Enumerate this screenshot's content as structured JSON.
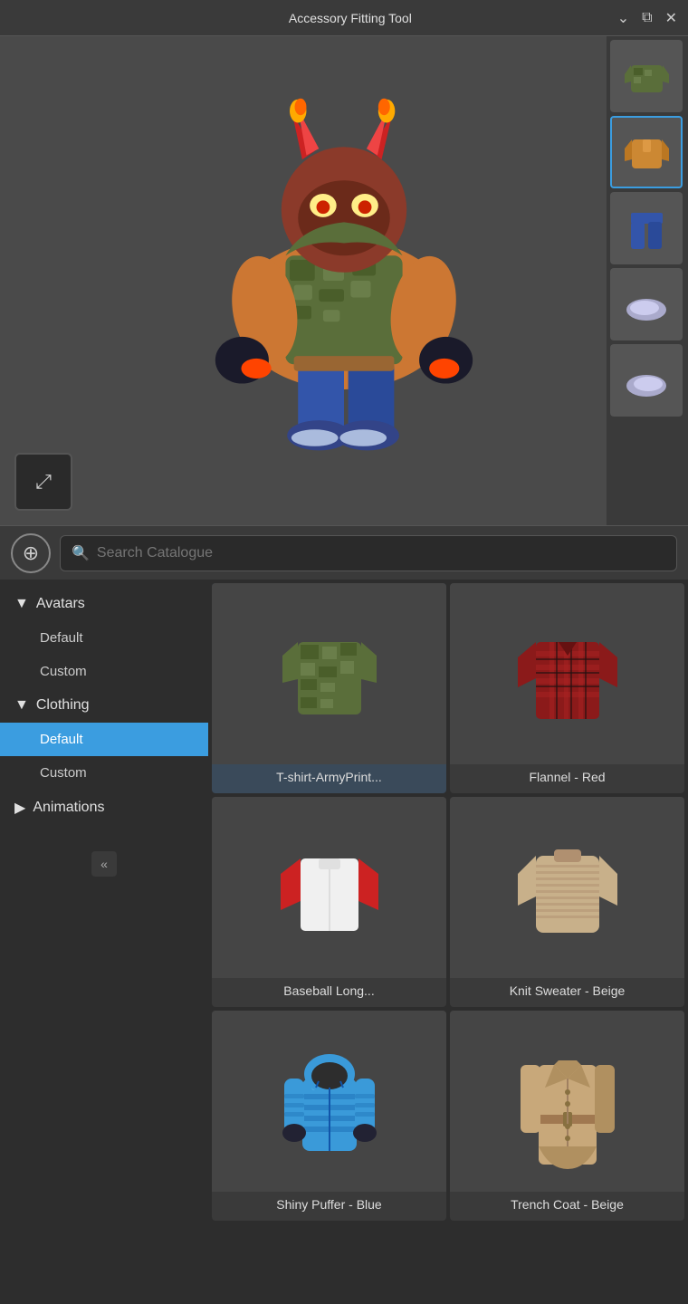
{
  "titleBar": {
    "title": "Accessory Fitting Tool",
    "controls": [
      "chevron-down",
      "maximize",
      "close"
    ]
  },
  "toolbar": {
    "searchPlaceholder": "Search Catalogue",
    "addButtonLabel": "+"
  },
  "thumbnailStrip": [
    {
      "id": "thumb-camo",
      "label": "Camo Shirt",
      "active": false
    },
    {
      "id": "thumb-jacket",
      "label": "Orange Jacket",
      "active": true
    },
    {
      "id": "thumb-pants",
      "label": "Blue Pants",
      "active": false
    },
    {
      "id": "thumb-shoe-left",
      "label": "Shoe Left",
      "active": false
    },
    {
      "id": "thumb-shoe-right",
      "label": "Shoe Right",
      "active": false
    }
  ],
  "sidebar": {
    "groups": [
      {
        "id": "avatars",
        "label": "Avatars",
        "expanded": true,
        "arrow": "▼",
        "items": [
          {
            "id": "avatars-default",
            "label": "Default",
            "active": false
          },
          {
            "id": "avatars-custom",
            "label": "Custom",
            "active": false
          }
        ]
      },
      {
        "id": "clothing",
        "label": "Clothing",
        "expanded": true,
        "arrow": "▼",
        "items": [
          {
            "id": "clothing-default",
            "label": "Default",
            "active": true
          },
          {
            "id": "clothing-custom",
            "label": "Custom",
            "active": false
          }
        ]
      },
      {
        "id": "animations",
        "label": "Animations",
        "expanded": false,
        "arrow": "▶",
        "items": []
      }
    ]
  },
  "catalogue": {
    "items": [
      {
        "id": "tshirt-armyprint",
        "label": "T-shirt-ArmyPrint...",
        "selected": true,
        "color1": "#4a5e3a",
        "color2": "#3a4e2a"
      },
      {
        "id": "flannel-red",
        "label": "Flannel - Red",
        "selected": false,
        "color1": "#8b1a1a",
        "color2": "#2a2a2a"
      },
      {
        "id": "baseball-long",
        "label": "Baseball Long...",
        "selected": false,
        "color1": "#ffffff",
        "color2": "#cc2222"
      },
      {
        "id": "knit-sweater-beige",
        "label": "Knit Sweater - Beige",
        "selected": false,
        "color1": "#c8b08a",
        "color2": "#b09070"
      },
      {
        "id": "shiny-puffer-blue",
        "label": "Shiny Puffer - Blue",
        "selected": false,
        "color1": "#3a9ad9",
        "color2": "#2277bb"
      },
      {
        "id": "trench-coat-beige",
        "label": "Trench Coat - Beige",
        "selected": false,
        "color1": "#c8a87a",
        "color2": "#b09060"
      }
    ]
  },
  "collapseBtn": "«",
  "externalBtn": "⬡",
  "colors": {
    "accent": "#3b9de0",
    "background": "#2d2d2d",
    "surface": "#3a3a3a",
    "border": "#555555"
  }
}
